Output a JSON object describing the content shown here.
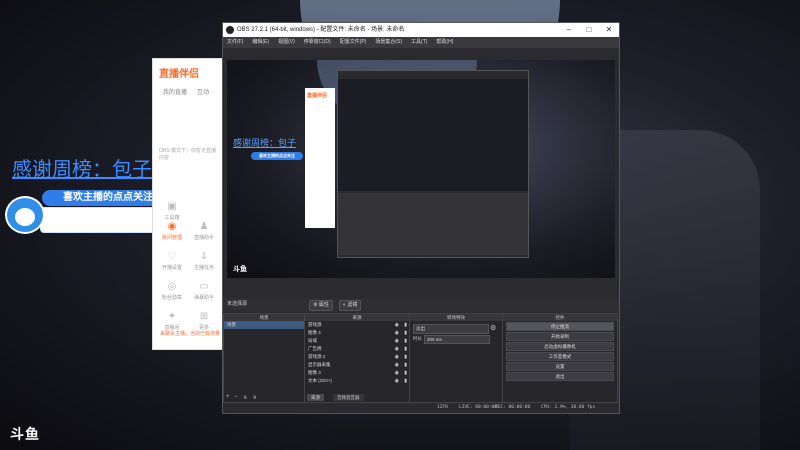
{
  "background": {
    "thanks_text": "感谢周榜：包子",
    "follow_text": "喜欢主播的点点关注",
    "logo": "斗鱼"
  },
  "helper_app": {
    "logo": "直播伴侣",
    "tab1": "我的直播",
    "tab2": "互动",
    "offline_text": "OBS 模式下，你暂无直播内容",
    "items": [
      "工具箱",
      "房间管理",
      "直播助手",
      "开播设置",
      "主播任务",
      "粉丝勋章",
      "弹幕助手",
      "直播间",
      "更多"
    ],
    "footer_text": "来聊会主播，当前已有流量",
    "footer2": "你会"
  },
  "obs": {
    "title": "OBS 27.2.1 (64-bit, windows) - 配置文件: 未命名 - 场景: 未命名",
    "menu": [
      "文件(F)",
      "编辑(E)",
      "视图(V)",
      "停靠窗口(D)",
      "配置文件(P)",
      "场景集合(S)",
      "工具(T)",
      "帮助(H)"
    ],
    "preview_logo": "斗鱼",
    "preview_thanks": "感谢周榜：包子",
    "preview_follow": "喜欢主播的点点关注",
    "preview_helper_logo": "直播伴侣",
    "toolbar": {
      "status": "未选择源",
      "props": "属性",
      "filters": "滤镜"
    },
    "scenes_header": "场景",
    "scenes": [
      "场景"
    ],
    "sources_header": "来源",
    "sources": [
      "游戏源",
      "图像 4",
      "局域",
      "广告牌",
      "游戏源 2",
      "显示器采集",
      "图像 3",
      "文本 (GDI+)"
    ],
    "mixer_header": "音频混音器",
    "transitions_header": "转场特效",
    "transition_value": "淡出",
    "duration_label": "时长",
    "duration_value": "300 ms",
    "controls_header": "控件",
    "controls": [
      "停止推流",
      "开始录制",
      "启动虚拟摄像机",
      "工作室模式",
      "设置",
      "退出"
    ],
    "dock_tabs": [
      "来源",
      "音频混音器"
    ],
    "status": {
      "live": "LIVE: 00:00:00",
      "rec": "REC: 00:00:00",
      "cpu": "CPU: 2.9%, 30.00 fps",
      "drop": "12FR"
    }
  }
}
